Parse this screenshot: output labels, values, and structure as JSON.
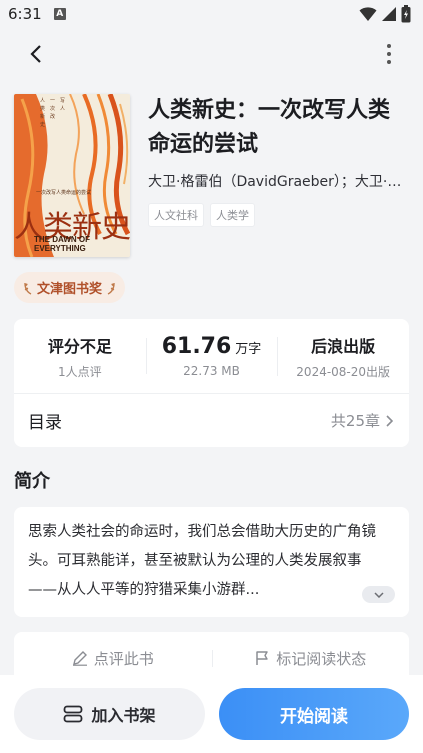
{
  "status_bar": {
    "time": "6:31",
    "sim_badge": "A"
  },
  "book": {
    "title": "人类新史：一次改写人类命运的尝试",
    "author": "大卫·格雷伯（DavidGraeber）；大卫·温格罗",
    "tags": [
      "人文社科",
      "人类学"
    ],
    "cover": {
      "title_cn": "人类新史",
      "title_en": "THE DAWN OF EVERYTHING"
    },
    "award": "文津图书奖"
  },
  "stats": {
    "rating": {
      "main": "评分不足",
      "sub": "1人点评"
    },
    "words": {
      "value": "61.76",
      "unit": "万字",
      "sub": "22.73 MB"
    },
    "publisher": {
      "main": "后浪出版",
      "sub": "2024-08-20出版"
    }
  },
  "toc": {
    "label": "目录",
    "count": "共25章"
  },
  "intro": {
    "section_title": "简介",
    "text": "思索人类社会的命运时，我们总会借助大历史的广角镜头。可耳熟能详，甚至被默认为公理的人类发展叙事——从人人平等的狩猎采集小游群..."
  },
  "actions": {
    "review": "点评此书",
    "mark_status": "标记阅读状态"
  },
  "bottom": {
    "add_shelf": "加入书架",
    "start_reading": "开始阅读"
  },
  "colors": {
    "accent": "#3b8ff6",
    "award": "#b0502a",
    "background": "#f3f4f6"
  }
}
